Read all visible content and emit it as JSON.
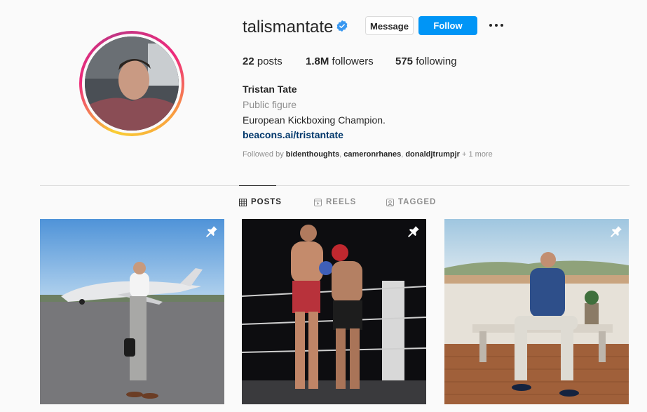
{
  "profile": {
    "username": "talismantate",
    "verified": true,
    "message_label": "Message",
    "follow_label": "Follow",
    "stats": {
      "posts_count": "22",
      "posts_label": "posts",
      "followers_count": "1.8M",
      "followers_label": "followers",
      "following_count": "575",
      "following_label": "following"
    },
    "full_name": "Tristan Tate",
    "category": "Public figure",
    "bio": "European Kickboxing Champion.",
    "link": "beacons.ai/tristantate",
    "followed_by_prefix": "Followed by",
    "followed_by_users": [
      "bidenthoughts",
      "cameronrhanes",
      "donaldjtrumpjr"
    ],
    "followed_by_suffix": "+ 1 more"
  },
  "tabs": [
    {
      "label": "POSTS",
      "icon": "grid-icon",
      "active": true
    },
    {
      "label": "REELS",
      "icon": "reels-icon",
      "active": false
    },
    {
      "label": "TAGGED",
      "icon": "tagged-icon",
      "active": false
    }
  ],
  "posts": [
    {
      "pinned": true
    },
    {
      "pinned": true
    },
    {
      "pinned": true
    }
  ],
  "colors": {
    "accent": "#0095f6",
    "verified": "#3897f0",
    "link": "#00376b",
    "muted": "#8e8e8e"
  }
}
